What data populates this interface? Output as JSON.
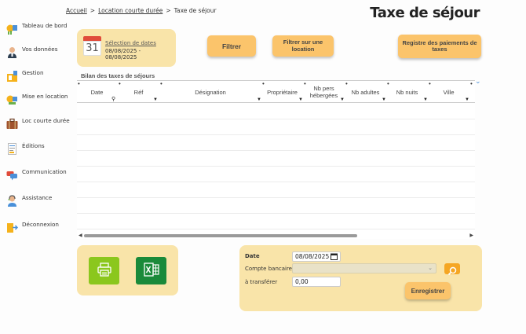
{
  "breadcrumb": {
    "home": "Accueil",
    "sep": ">",
    "parent": "Location courte durée",
    "current": "Taxe de séjour"
  },
  "page_title": "Taxe de séjour",
  "sidebar": {
    "items": [
      {
        "label": "Tableau de bord",
        "icon": "dashboard-icon"
      },
      {
        "label": "Vos données",
        "icon": "user-icon"
      },
      {
        "label": "Gestion",
        "icon": "management-icon"
      },
      {
        "label": "Mise en location",
        "icon": "rental-icon"
      },
      {
        "label": "Loc courte durée",
        "icon": "suitcase-icon"
      },
      {
        "label": "Éditions",
        "icon": "document-icon"
      },
      {
        "label": "Communication",
        "icon": "chat-icon"
      },
      {
        "label": "Assistance",
        "icon": "support-icon"
      },
      {
        "label": "Déconnexion",
        "icon": "logout-icon"
      }
    ]
  },
  "date_panel": {
    "calendar_day": "31",
    "link_label": "Sélection de dates",
    "range": "08/08/2025 - 08/08/2025"
  },
  "buttons": {
    "filter": "Filtrer",
    "filter_location": "Filtrer sur une location",
    "register": "Registre des paiements de taxes"
  },
  "table": {
    "title": "Bilan des taxes de séjours",
    "columns": [
      "Date",
      "Réf",
      "Désignation",
      "Propriétaire",
      "Nb pers hébergées",
      "Nb adultes",
      "Nb nuits",
      "Ville"
    ],
    "rows": []
  },
  "form": {
    "date_label": "Date",
    "date_value": "08/08/2025",
    "account_label": "Compte bancaire",
    "account_value": "",
    "transfer_label": "à transférer",
    "transfer_value": "0,00",
    "save_label": "Enregistrer"
  },
  "colors": {
    "panel": "#f9e4a9",
    "button": "#fbc46b",
    "print_green": "#8bc71d",
    "excel_green": "#1a8a3a"
  }
}
